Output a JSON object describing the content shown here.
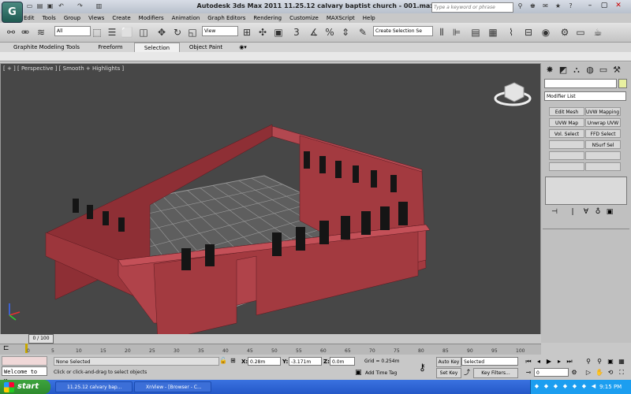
{
  "window": {
    "title": "Autodesk 3ds Max  2011      11.25.12 calvary baptist church - 001.max",
    "search_placeholder": "Type a keyword or phrase",
    "app_button": "G"
  },
  "menu": [
    "Edit",
    "Tools",
    "Group",
    "Views",
    "Create",
    "Modifiers",
    "Animation",
    "Graph Editors",
    "Rendering",
    "Customize",
    "MAXScript",
    "Help"
  ],
  "toolbar": {
    "selection_filter": "All",
    "ref_coord": "View",
    "named_selection": "Create Selection Se",
    "snap_values": [
      "3",
      "%",
      "n"
    ]
  },
  "ribbon": {
    "tabs": [
      "Graphite Modeling Tools",
      "Freeform",
      "Selection",
      "Object Paint"
    ],
    "active": "Selection"
  },
  "viewport": {
    "label": "[ + ] [ Perspective ] [ Smooth + Highlights ]",
    "model_color": "#a33a40",
    "floor_color": "#6a6a6a",
    "grid_line_color": "#9a9a9a",
    "background": "#474747"
  },
  "command_panel": {
    "modifier_list": "Modifier List",
    "modifier_buttons": [
      [
        "Edit Mesh",
        "UVW Mapping Ac"
      ],
      [
        "UVW Map",
        "Unwrap UVW"
      ],
      [
        "Vol. Select",
        "FFD Select"
      ],
      [
        "",
        "NSurf Sel"
      ],
      [
        "",
        ""
      ],
      [
        "",
        ""
      ]
    ]
  },
  "timeline": {
    "slider_label": "0 / 100",
    "ticks": [
      "0",
      "5",
      "10",
      "15",
      "20",
      "25",
      "30",
      "35",
      "40",
      "45",
      "50",
      "55",
      "60",
      "65",
      "70",
      "75",
      "80",
      "85",
      "90",
      "95",
      "100"
    ]
  },
  "status": {
    "listener": "Welcome to M:",
    "selection": "None Selected",
    "prompt": "Click or click-and-drag to select objects",
    "x_label": "X:",
    "x": "0.28m",
    "y_label": "Y:",
    "y": "-3.171m",
    "z_label": "Z:",
    "z": "0.0m",
    "grid": "Grid = 0.254m",
    "add_time_tag": "Add Time Tag",
    "auto_key": "Auto Key",
    "set_key": "Set Key",
    "key_mode": "Selected",
    "key_filters": "Key Filters...",
    "frame": "0"
  },
  "taskbar": {
    "start": "start",
    "tasks": [
      "11.25.12 calvary bap...",
      "XnView - [Browser - C..."
    ],
    "clock": "9:15 PM"
  }
}
